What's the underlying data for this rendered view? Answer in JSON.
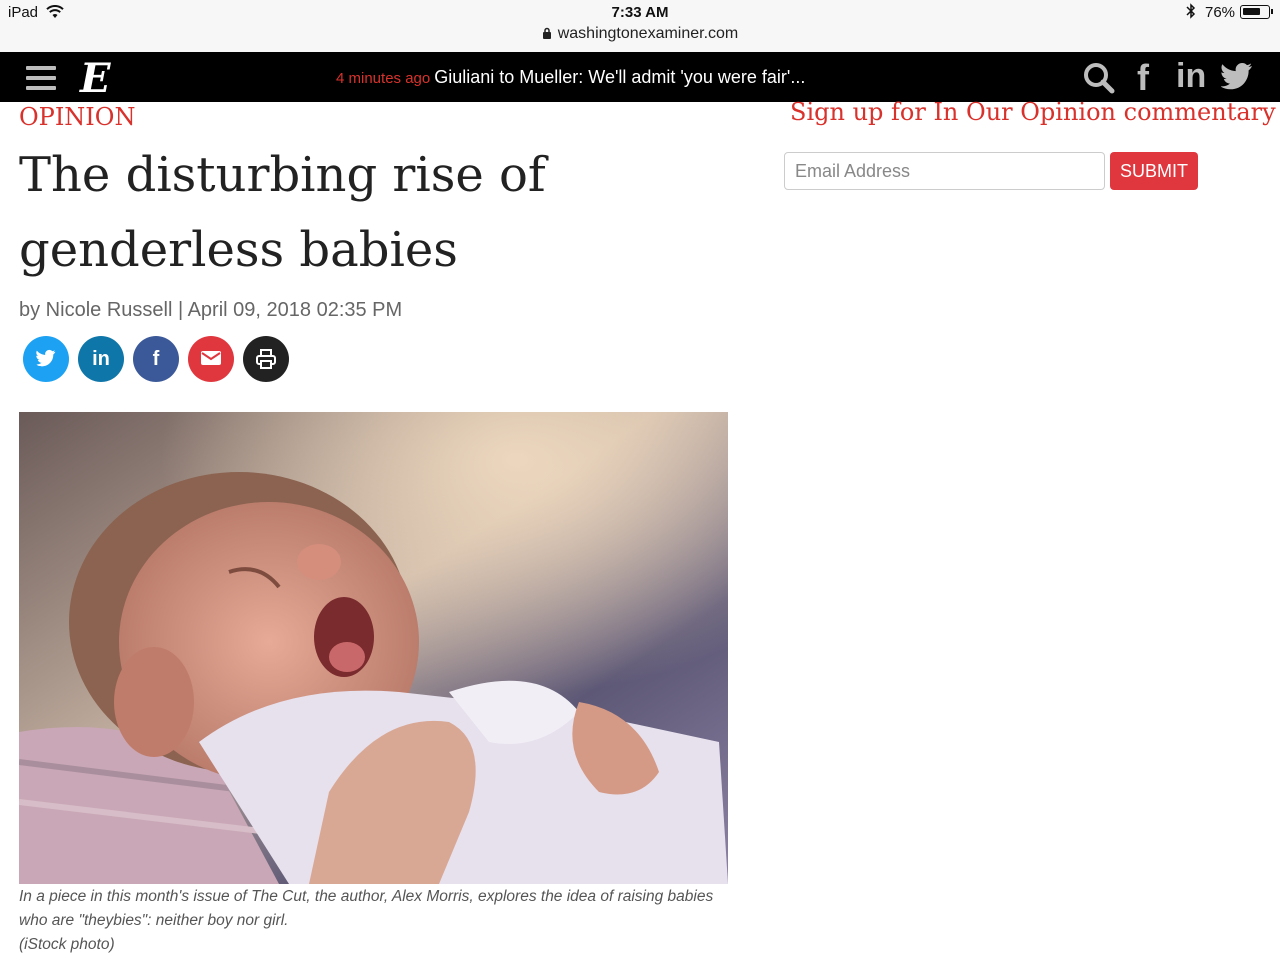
{
  "status_bar": {
    "device": "iPad",
    "time": "7:33 AM",
    "url": "washingtonexaminer.com",
    "battery_percent": "76%",
    "battery_level": 0.76
  },
  "navbar": {
    "logo": "E",
    "ticker_time": "4 minutes ago",
    "ticker_headline": "Giuliani to Mueller: We'll admit 'you were fair'..."
  },
  "article": {
    "category": "OPINION",
    "headline": "The disturbing rise of genderless babies",
    "byline": "by Nicole Russell | April 09, 2018 02:35 PM",
    "caption_line1": "In a piece in this month's issue of The Cut, the author, Alex Morris, explores the idea of raising babies who are \"theybies\": neither boy nor girl.",
    "caption_line2": "(iStock photo)"
  },
  "share_buttons": [
    {
      "name": "twitter",
      "color": "#1da1f2"
    },
    {
      "name": "linkedin",
      "color": "#0e76a8"
    },
    {
      "name": "facebook",
      "color": "#3b5998"
    },
    {
      "name": "email",
      "color": "#e0373f"
    },
    {
      "name": "print",
      "color": "#222222"
    }
  ],
  "newsletter": {
    "title": "Sign up for In Our Opinion commentary",
    "email_placeholder": "Email Address",
    "submit_label": "SUBMIT"
  },
  "colors": {
    "accent_red": "#d9312b",
    "navbar_bg": "#000000"
  }
}
